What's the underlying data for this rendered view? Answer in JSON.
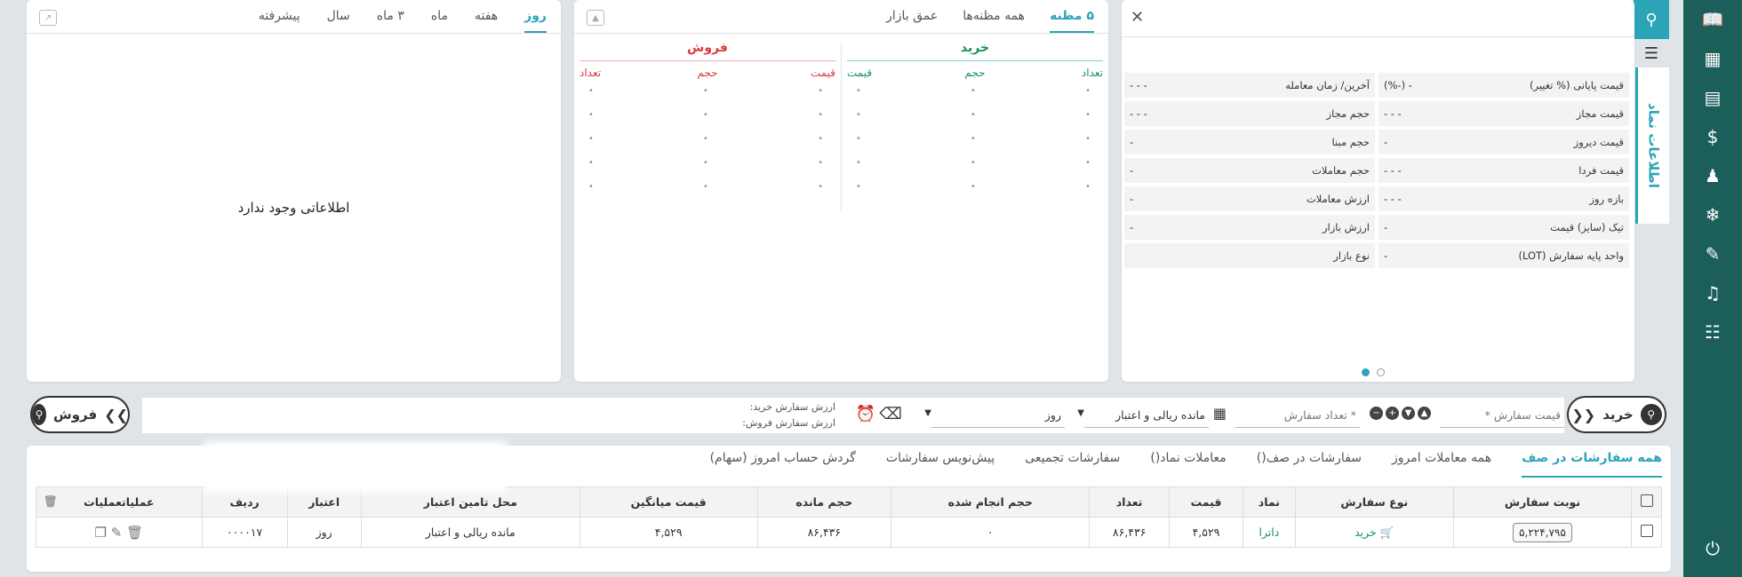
{
  "rail": {
    "icons": [
      "book-open-icon",
      "id-card-icon",
      "credit-card-icon",
      "dollar-icon",
      "user-plus-icon",
      "snowflake-icon",
      "edit-file-icon",
      "bell-icon",
      "table-icon"
    ],
    "logout_icon": "power-icon"
  },
  "symbol_panel": {
    "side_tab_label": "اطلاعات نماد",
    "rows": [
      {
        "right_label": "قیمت پایانی (% تغییر)",
        "right_value": "- (-%)",
        "left_label": "آخرین/ زمان معامله",
        "left_value": "- - -"
      },
      {
        "right_label": "قیمت مجاز",
        "right_value": "- - -",
        "left_label": "حجم مجاز",
        "left_value": "- - -"
      },
      {
        "right_label": "قیمت دیروز",
        "right_value": "-",
        "left_label": "حجم مبنا",
        "left_value": "-"
      },
      {
        "right_label": "قیمت فردا",
        "right_value": "- - -",
        "left_label": "حجم معاملات",
        "left_value": "-"
      },
      {
        "right_label": "بازه روز",
        "right_value": "- - -",
        "left_label": "ارزش معاملات",
        "left_value": "-"
      },
      {
        "right_label": "تیک (سایز) قیمت",
        "right_value": "-",
        "left_label": "ارزش بازار",
        "left_value": "-"
      },
      {
        "right_label": "واحد پایه سفارش (LOT)",
        "right_value": "-",
        "left_label": "نوع بازار",
        "left_value": ""
      }
    ]
  },
  "book_panel": {
    "tabs": [
      "۵ مظنه",
      "همه مظنه‌ها",
      "عمق بازار"
    ],
    "buy_title": "خرید",
    "sell_title": "فروش",
    "buy_cols": [
      "تعداد",
      "حجم",
      "قیمت"
    ],
    "sell_cols": [
      "قیمت",
      "حجم",
      "تعداد"
    ],
    "row_mark": "•"
  },
  "chart_panel": {
    "tabs": [
      "روز",
      "هفته",
      "ماه",
      "۳ ماه",
      "سال",
      "پیشرفته"
    ],
    "empty_text": "اطلاعاتی وجود ندارد"
  },
  "entry": {
    "buy_label": "خرید",
    "sell_label": "فروش",
    "price_placeholder": "قیمت سفارش *",
    "qty_placeholder": "* تعداد سفارش",
    "credit_select": "مانده ریالی و اعتبار",
    "validity_select": "روز",
    "buy_value_label": "ارزش سفارش خرید:",
    "sell_value_label": "ارزش سفارش فروش:"
  },
  "orders": {
    "tabs": [
      "همه سفارشات در صف",
      "همه معاملات امروز",
      "سفارشات در صف()",
      "معاملات نماد()",
      "سفارشات تجمیعی",
      "پیش‌نویس سفارشات",
      "گردش حساب امروز (سهام)"
    ],
    "columns": [
      "نوبت سفارش",
      "نوع سفارش",
      "نماد",
      "قیمت",
      "تعداد",
      "حجم انجام شده",
      "حجم مانده",
      "قیمت میانگین",
      "محل تامین اعتبار",
      "اعتبار",
      "ردیف",
      "عملیات"
    ],
    "rows": [
      {
        "queue": "۵,۲۲۴,۷۹۵",
        "type": "خرید",
        "symbol": "داترا",
        "price": "۴,۵۲۹",
        "qty": "۸۶,۴۳۶",
        "done": "۰",
        "remain": "۸۶,۴۳۶",
        "avg": "۴,۵۲۹",
        "source": "مانده ریالی و اعتبار",
        "validity": "روز",
        "row": "۰۰۰۰۱۷"
      }
    ]
  }
}
